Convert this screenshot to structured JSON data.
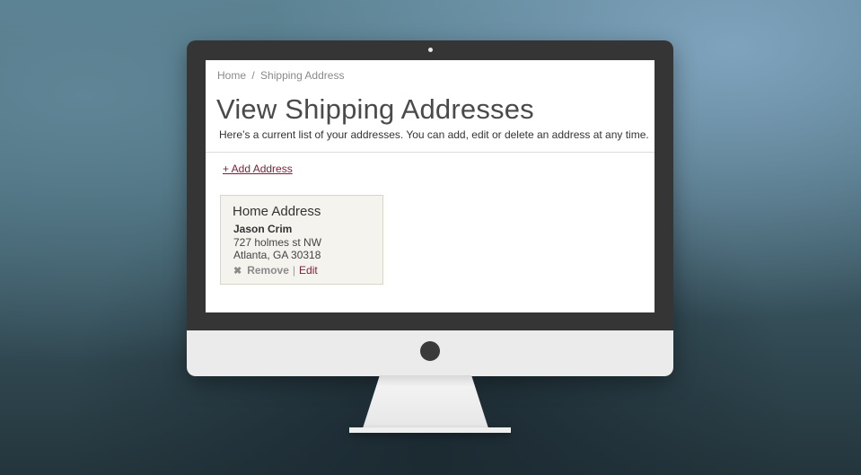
{
  "breadcrumb": {
    "home": "Home",
    "separator": "/",
    "current": "Shipping Address"
  },
  "page": {
    "title": "View Shipping Addresses",
    "subtitle": "Here’s a current list of your addresses. You can add, edit or delete an address at any time.",
    "add_link": "+ Add Address"
  },
  "addresses": [
    {
      "title": "Home Address",
      "name": "Jason Crim",
      "line1": "727 holmes st NW",
      "line2": "Atlanta, GA 30318",
      "remove_label": "Remove",
      "separator": "|",
      "edit_label": "Edit"
    }
  ],
  "icons": {
    "remove": "close-icon",
    "remove_glyph": "✖"
  },
  "colors": {
    "accent": "#7a1f35",
    "card_bg": "#f5f3ee",
    "bezel": "#353535"
  }
}
